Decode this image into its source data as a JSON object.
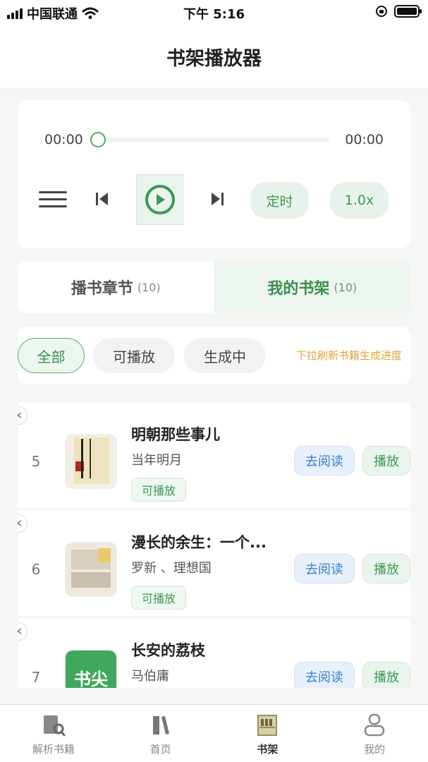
{
  "status_bar": {
    "carrier": "中国联通",
    "time": "下午 5:16"
  },
  "header": {
    "title": "书架播放器"
  },
  "player": {
    "current_time": "00:00",
    "total_time": "00:00",
    "progress": 0,
    "timer_label": "定时",
    "speed_label": "1.0x"
  },
  "tabs": [
    {
      "label": "播书章节",
      "count": "(10)",
      "active": false
    },
    {
      "label": "我的书架",
      "count": "(10)",
      "active": true
    }
  ],
  "filters": {
    "chips": [
      {
        "label": "全部",
        "active": true
      },
      {
        "label": "可播放",
        "active": false
      },
      {
        "label": "生成中",
        "active": false
      }
    ],
    "hint": "下拉刷新书籍生成进度"
  },
  "books": [
    {
      "rank": "5",
      "title": "明朝那些事儿",
      "author": "当年明月",
      "status": "可播放",
      "read_label": "去阅读",
      "play_label": "播放"
    },
    {
      "rank": "6",
      "title": "漫长的余生：一个...",
      "author": "罗新 、理想国",
      "status": "可播放",
      "read_label": "去阅读",
      "play_label": "播放"
    },
    {
      "rank": "7",
      "title": "长安的荔枝",
      "author": "马伯庸",
      "cover_text": "书尖",
      "read_label": "去阅读",
      "play_label": "播放"
    }
  ],
  "bottom_nav": [
    {
      "label": "解析书籍",
      "icon": "book-search-icon",
      "active": false
    },
    {
      "label": "首页",
      "icon": "books-icon",
      "active": false
    },
    {
      "label": "书架",
      "icon": "bookshelf-icon",
      "active": true
    },
    {
      "label": "我的",
      "icon": "user-icon",
      "active": false
    }
  ],
  "colors": {
    "accent_green": "#3b9955",
    "link_blue": "#3e7fd0",
    "hint_orange": "#e0a33a"
  }
}
